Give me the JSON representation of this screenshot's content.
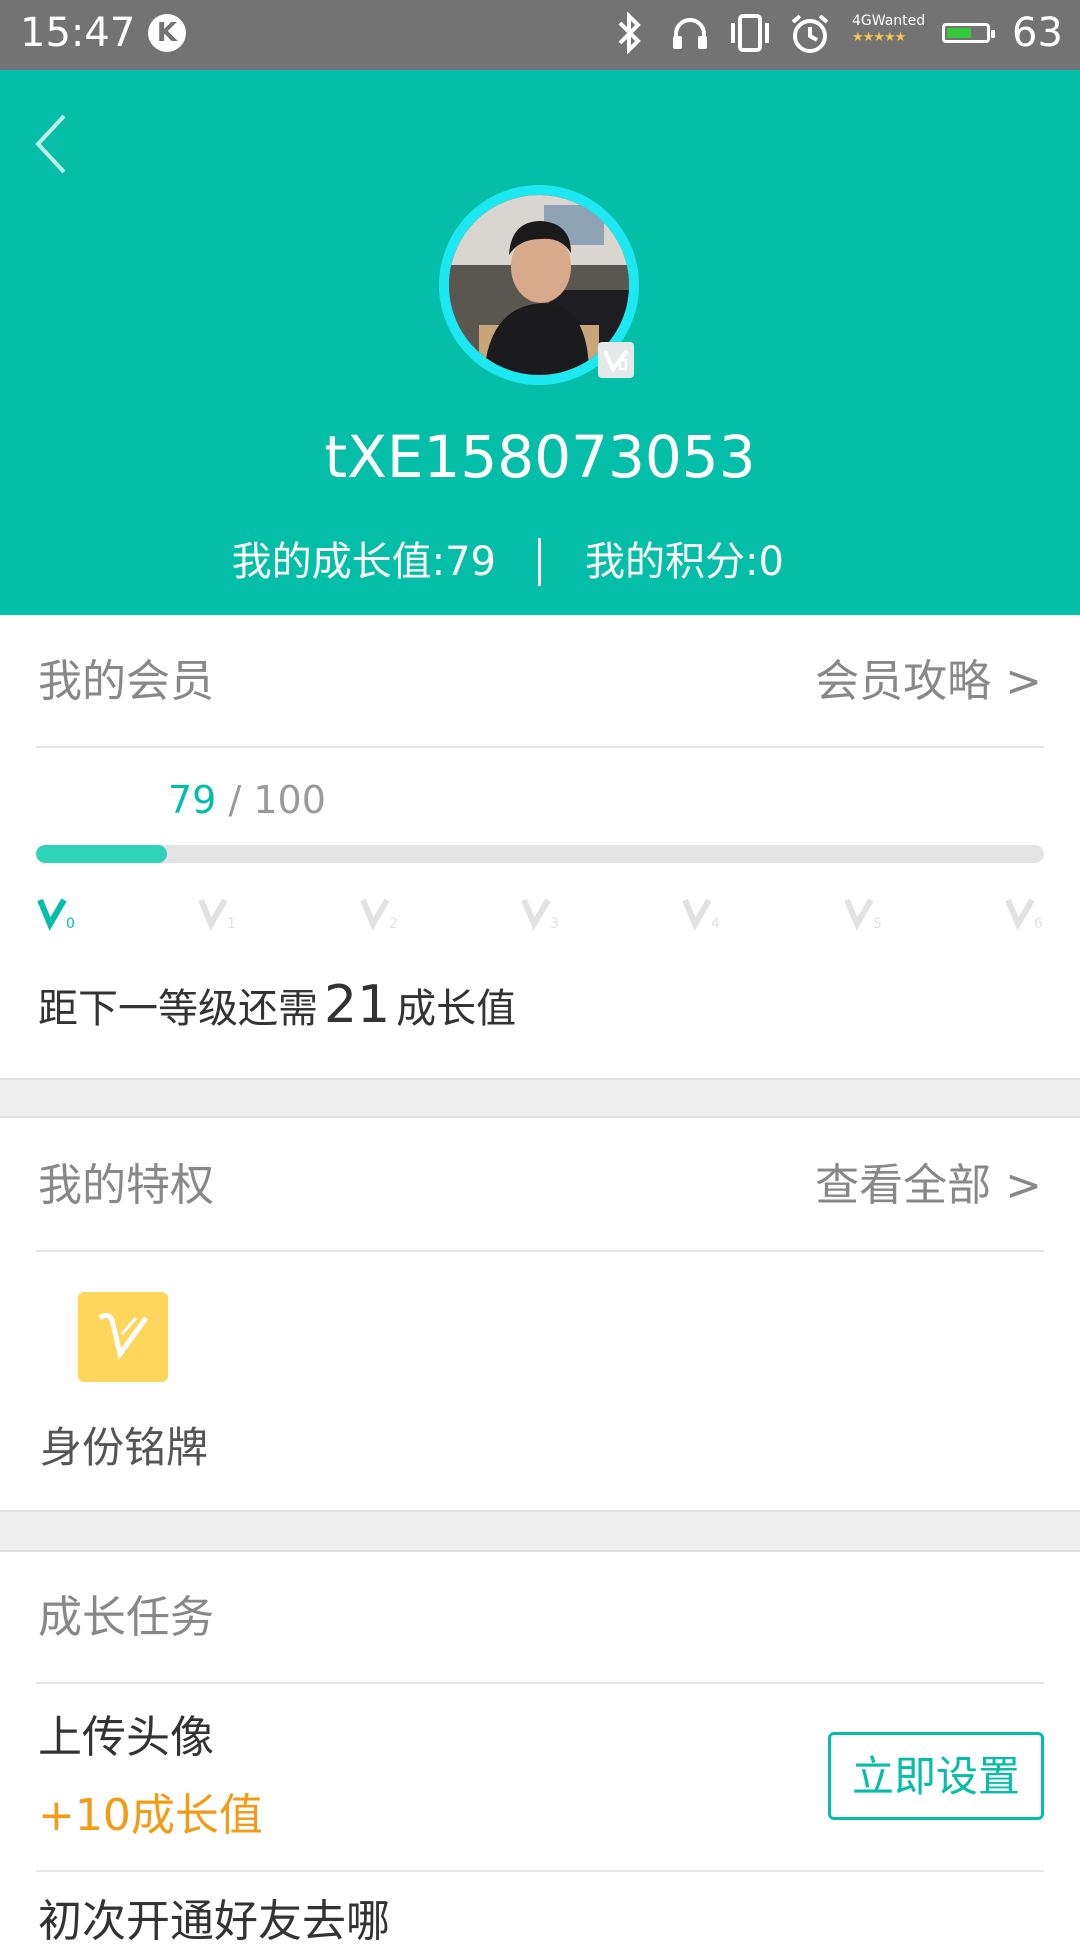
{
  "status_bar": {
    "time": "15:47",
    "notification_icon": "K",
    "network_text": "4GWanted",
    "network_stars": "★★★★★",
    "battery_level": 0.63,
    "battery_percent": "63"
  },
  "profile": {
    "username": "tXE158073053",
    "growth_label": "我的成长值:79",
    "points_label": "我的积分:0"
  },
  "membership": {
    "title": "我的会员",
    "link": "会员攻略 >",
    "current": "79",
    "max": "/ 100",
    "progress": 0.13,
    "levels": [
      "V0",
      "V1",
      "V2",
      "V3",
      "V4",
      "V5",
      "V6"
    ],
    "next_prefix": "距下一等级还需",
    "next_value": "21",
    "next_suffix": "成长值"
  },
  "privileges": {
    "title": "我的特权",
    "link": "查看全部 >",
    "items": [
      {
        "label": "身份铭牌",
        "icon": "v-badge-icon"
      }
    ]
  },
  "tasks": {
    "title": "成长任务",
    "items": [
      {
        "name": "上传头像",
        "reward": "+10成长值",
        "button": "立即设置"
      },
      {
        "name": "初次开通好友去哪"
      }
    ]
  },
  "colors": {
    "accent": "#05bea8",
    "progress": "#2fd3b7",
    "reward": "#f29b17",
    "badge": "#fdd65b"
  }
}
